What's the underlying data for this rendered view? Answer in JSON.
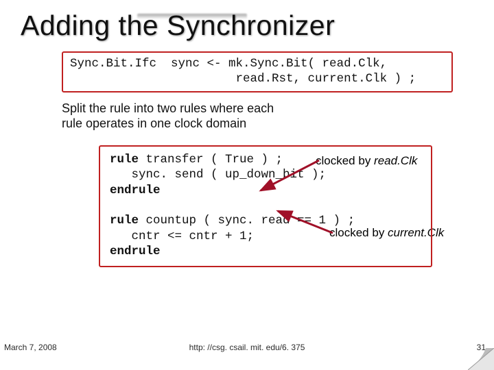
{
  "title": "Adding the Synchronizer",
  "decl_box": "Sync.Bit.Ifc  sync <- mk.Sync.Bit( read.Clk,\n                       read.Rst, current.Clk ) ;",
  "explain_line1": "Split the rule into two rules where each",
  "explain_line2": "rule operates in one clock domain",
  "clock_label_1_prefix": "clocked by ",
  "clock_label_1_em": "read.Clk",
  "clock_label_2_prefix": "clocked by ",
  "clock_label_2_em": "current.Clk",
  "rules_box": {
    "l1a": "rule",
    "l1b": " transfer ( True ) ;",
    "l2": "   sync. send ( up_down_bit );",
    "l3": "endrule",
    "gap": "",
    "l4a": "rule",
    "l4b": " countup ( sync. read == 1 ) ;",
    "l5": "   cntr <= cntr + 1;",
    "l6": "endrule"
  },
  "footer": {
    "date": "March 7, 2008",
    "url": "http: //csg. csail. mit. edu/6. 375",
    "pagenum": "31"
  },
  "arrow_color": "#a01028"
}
